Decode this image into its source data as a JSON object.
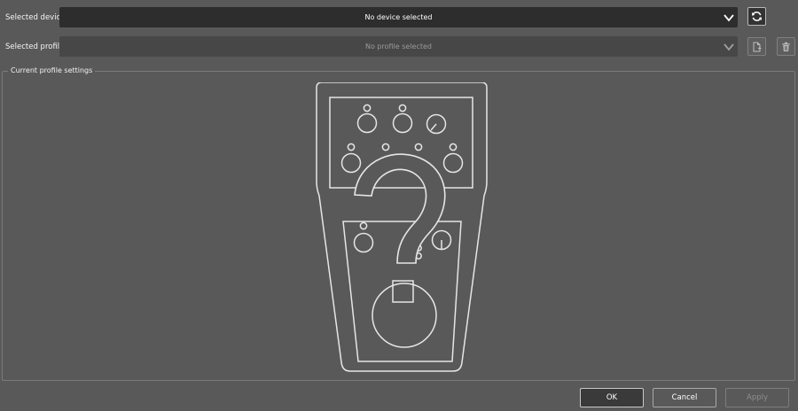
{
  "device": {
    "label": "Selected device",
    "value": "No device selected",
    "refresh_icon": "refresh-icon"
  },
  "profile": {
    "label": "Selected profile",
    "value": "No profile selected",
    "new_icon": "new-file-icon",
    "delete_icon": "trash-icon"
  },
  "settings": {
    "title": "Current profile settings",
    "illustration": "unknown-device-question-mark"
  },
  "buttons": {
    "ok": "OK",
    "cancel": "Cancel",
    "apply": "Apply"
  },
  "colors": {
    "background": "#595959",
    "combo_dark": "#2d2d2d",
    "outline": "#e6e6e6"
  }
}
